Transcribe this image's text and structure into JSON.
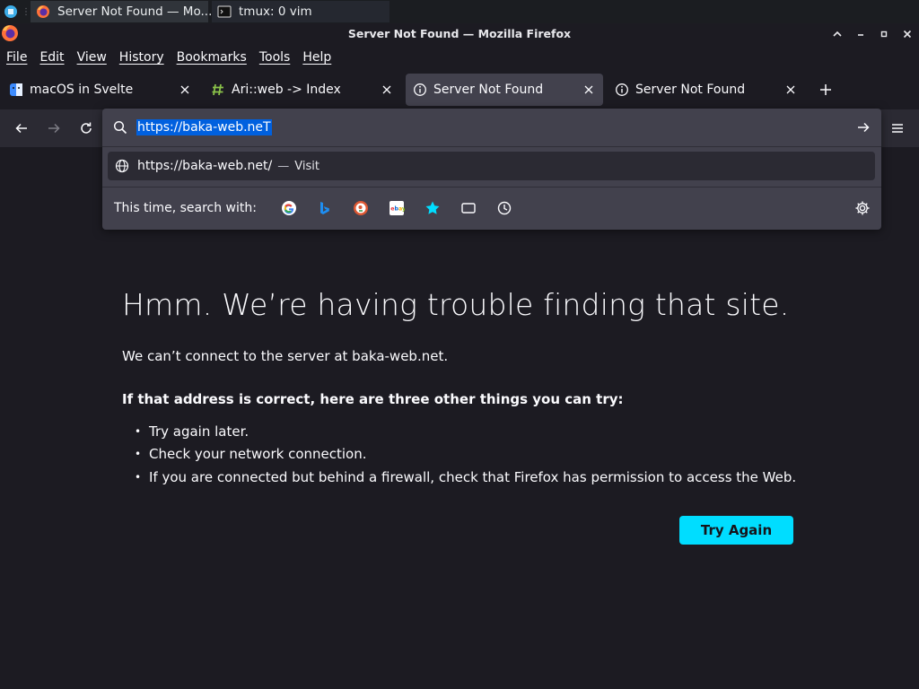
{
  "taskbar": {
    "tasks": [
      {
        "label": "Server Not Found — Mo...",
        "icon": "firefox-icon"
      },
      {
        "label": "tmux: 0 vim",
        "icon": "terminal-icon"
      }
    ]
  },
  "window": {
    "title": "Server Not Found — Mozilla Firefox"
  },
  "menu": {
    "items": [
      "File",
      "Edit",
      "View",
      "History",
      "Bookmarks",
      "Tools",
      "Help"
    ]
  },
  "tabs": [
    {
      "label": "macOS in Svelte",
      "icon": "finder-icon",
      "selected": false
    },
    {
      "label": "Ari::web -> Index",
      "icon": "hash-icon",
      "selected": false
    },
    {
      "label": "Server Not Found",
      "icon": "info-icon",
      "selected": true
    },
    {
      "label": "Server Not Found",
      "icon": "info-icon",
      "selected": false
    }
  ],
  "urlbar": {
    "value": "https://baka-web.neT",
    "suggestion": {
      "url": "https://baka-web.net/",
      "dash": "—",
      "action": "Visit"
    },
    "oneoff_label": "This time, search with:",
    "engines": [
      "google-icon",
      "bing-icon",
      "duckduckgo-icon",
      "ebay-icon",
      "bookmarks-icon",
      "tabs-icon",
      "history-icon"
    ]
  },
  "error": {
    "title": "Hmm. We’re having trouble finding that site.",
    "description": "We can’t connect to the server at baka-web.net.",
    "suggestions_heading": "If that address is correct, here are three other things you can try:",
    "suggestions": [
      "Try again later.",
      "Check your network connection.",
      "If you are connected but behind a firewall, check that Firefox has permission to access the Web."
    ],
    "try_again": "Try Again"
  },
  "colors": {
    "accent": "#00ddff",
    "selection": "#0060df",
    "page_bg": "#1c1b22"
  }
}
